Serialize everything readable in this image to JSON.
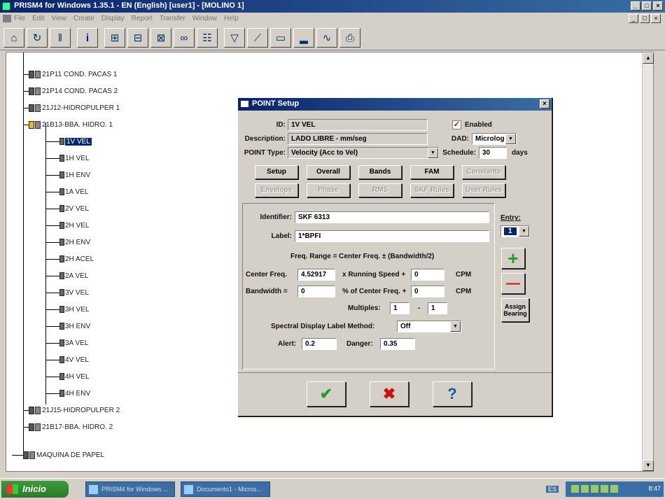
{
  "window": {
    "title": "PRISM4 for Windows 1.35.1 - EN (English) [user1] - [MOLINO 1]"
  },
  "menu": [
    "File",
    "Edit",
    "View",
    "Create",
    "Display",
    "Report",
    "Transfer",
    "Window",
    "Help"
  ],
  "toolbar": {
    "buttons": [
      "hierarchy-icon",
      "route-icon",
      "tag-icon",
      "info-icon",
      "point-icon",
      "point-add-icon",
      "point-edit-icon",
      "link-icon",
      "machines-icon",
      "filter-icon",
      "trend-icon",
      "graph-icon",
      "spectrum-icon",
      "waveform-icon",
      "print-icon"
    ]
  },
  "tree": {
    "nodes": [
      {
        "label": "21P11 COND. PACAS 1"
      },
      {
        "label": "21P14 COND. PACAS 2"
      },
      {
        "label": "21J12-HIDROPULPER 1"
      },
      {
        "label": "21B13-BBA. HIDRO. 1"
      },
      {
        "label": "1V VEL",
        "selected": true
      },
      {
        "label": "1H VEL"
      },
      {
        "label": "1H ENV"
      },
      {
        "label": "1A VEL"
      },
      {
        "label": "2V VEL"
      },
      {
        "label": "2H VEL"
      },
      {
        "label": "2H ENV"
      },
      {
        "label": "2H ACEL"
      },
      {
        "label": "2A VEL"
      },
      {
        "label": "3V VEL"
      },
      {
        "label": "3H VEL"
      },
      {
        "label": "3H ENV"
      },
      {
        "label": "3A VEL"
      },
      {
        "label": "4V VEL"
      },
      {
        "label": "4H VEL"
      },
      {
        "label": "4H ENV"
      },
      {
        "label": "21J15-HIDROPULPER 2"
      },
      {
        "label": "21B17-BBA. HIDRO. 2"
      },
      {
        "label": "MAQUINA DE PAPEL"
      }
    ]
  },
  "dialog": {
    "title": "POINT Setup",
    "id_label": "ID:",
    "id_value": "1V VEL",
    "enabled_label": "Enabled",
    "desc_label": "Description:",
    "desc_value": "LADO LIBRE - mm/seg",
    "dad_label": "DAD:",
    "dad_value": "Microlog",
    "type_label": "POINT Type:",
    "type_value": "Velocity (Acc to Vel)",
    "schedule_label": "Schedule:",
    "schedule_value": "30",
    "schedule_unit": "days",
    "tabs_row1": [
      "Setup",
      "Overall",
      "Bands",
      "FAM",
      "Constants"
    ],
    "tabs_row2": [
      "Envelope",
      "Phase",
      "RMS",
      "SKF Rules",
      "User Rules"
    ],
    "identifier_label": "Identifier:",
    "identifier_value": "SKF 6313",
    "label_label": "Label:",
    "label_value": "1*BPFI",
    "freq_note": "Freq. Range = Center Freq. ± (Bandwidth/2)",
    "center_label": "Center Freq.",
    "center_value": "4.52917",
    "running_label": "x Running Speed +",
    "running_value": "0",
    "cpm1": "CPM",
    "bandwidth_label": "Bandwidth =",
    "bandwidth_value": "0",
    "pct_label": "% of Center Freq. +",
    "pct_value": "0",
    "cpm2": "CPM",
    "multiples_label": "Multiples:",
    "mult_from": "1",
    "mult_dash": "-",
    "mult_to": "1",
    "spectral_label": "Spectral Display Label Method:",
    "spectral_value": "Off",
    "alert_label": "Alert:",
    "alert_value": "0.2",
    "danger_label": "Danger:",
    "danger_value": "0.35",
    "entry_label": "Entry:",
    "entry_value": "1",
    "add_symbol": "+",
    "remove_symbol": "—",
    "assign_label": "Assign Bearing",
    "ok_symbol": "✔",
    "cancel_symbol": "✖",
    "help_symbol": "?"
  },
  "taskbar": {
    "start_label": "Inicio",
    "tasks": [
      "PRISM4 for Windows ...",
      "Documento1 - Micros..."
    ],
    "lang": "ES",
    "time": "8:47"
  },
  "colors": {
    "titlebar": "#0a246a",
    "selection": "#0a246a",
    "ok": "#2a9a2a",
    "cancel": "#cc1111",
    "help": "#0a5ab0"
  }
}
